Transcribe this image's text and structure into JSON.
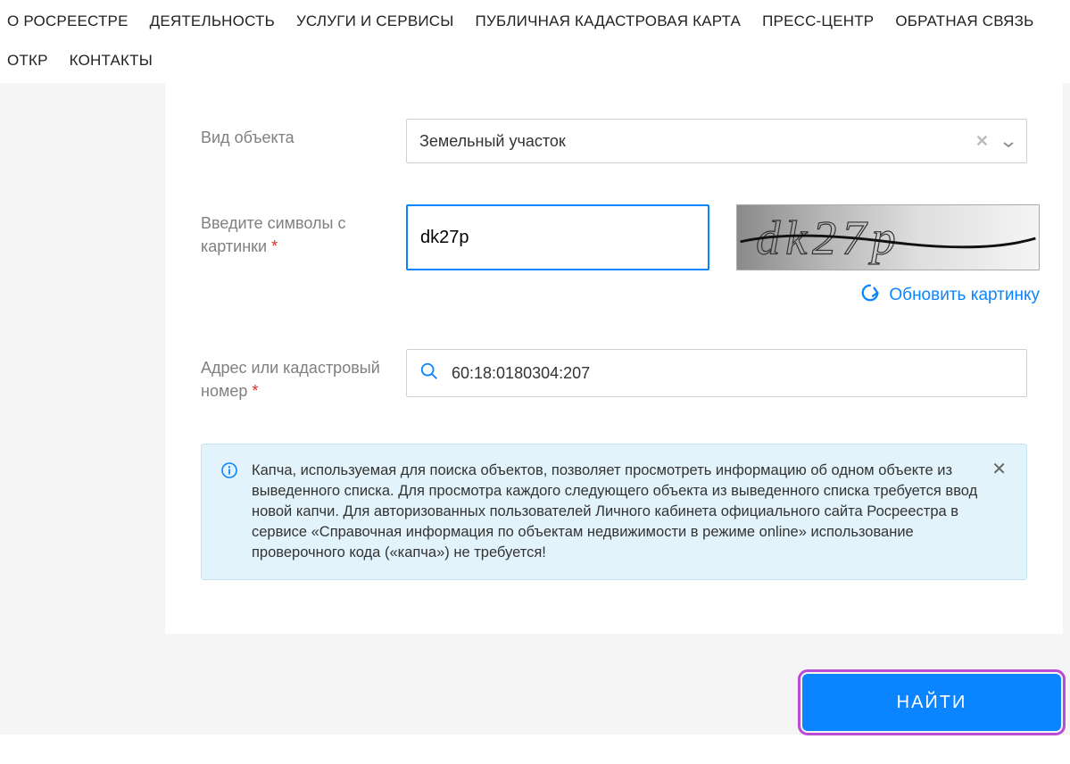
{
  "nav": {
    "items": [
      "О РОСРЕЕСТРЕ",
      "ДЕЯТЕЛЬНОСТЬ",
      "УСЛУГИ И СЕРВИСЫ",
      "ПУБЛИЧНАЯ КАДАСТРОВАЯ КАРТА",
      "ПРЕСС-ЦЕНТР",
      "ОБРАТНАЯ СВЯЗЬ",
      "ОТКР",
      "КОНТАКТЫ"
    ]
  },
  "form": {
    "object_type": {
      "label": "Вид объекта",
      "value": "Земельный участок"
    },
    "captcha": {
      "label": "Введите символы с картинки",
      "required_mark": "*",
      "value": "dk27p",
      "image_text": "dk27p",
      "refresh_label": "Обновить картинку"
    },
    "address": {
      "label": "Адрес или кадастровый номер",
      "required_mark": "*",
      "value": "60:18:0180304:207"
    },
    "info": {
      "text": "Капча, используемая для поиска объектов, позволяет просмотреть информацию об одном объекте из выведенного списка. Для просмотра каждого следующего объекта из выведенного списка требуется ввод новой капчи. Для авторизованных пользователей Личного кабинета официального сайта Росреестра в сервисе «Справочная информация по объектам недвижимости в режиме online» использование проверочного кода («капча») не требуется!"
    },
    "submit": {
      "label": "НАЙТИ"
    }
  }
}
